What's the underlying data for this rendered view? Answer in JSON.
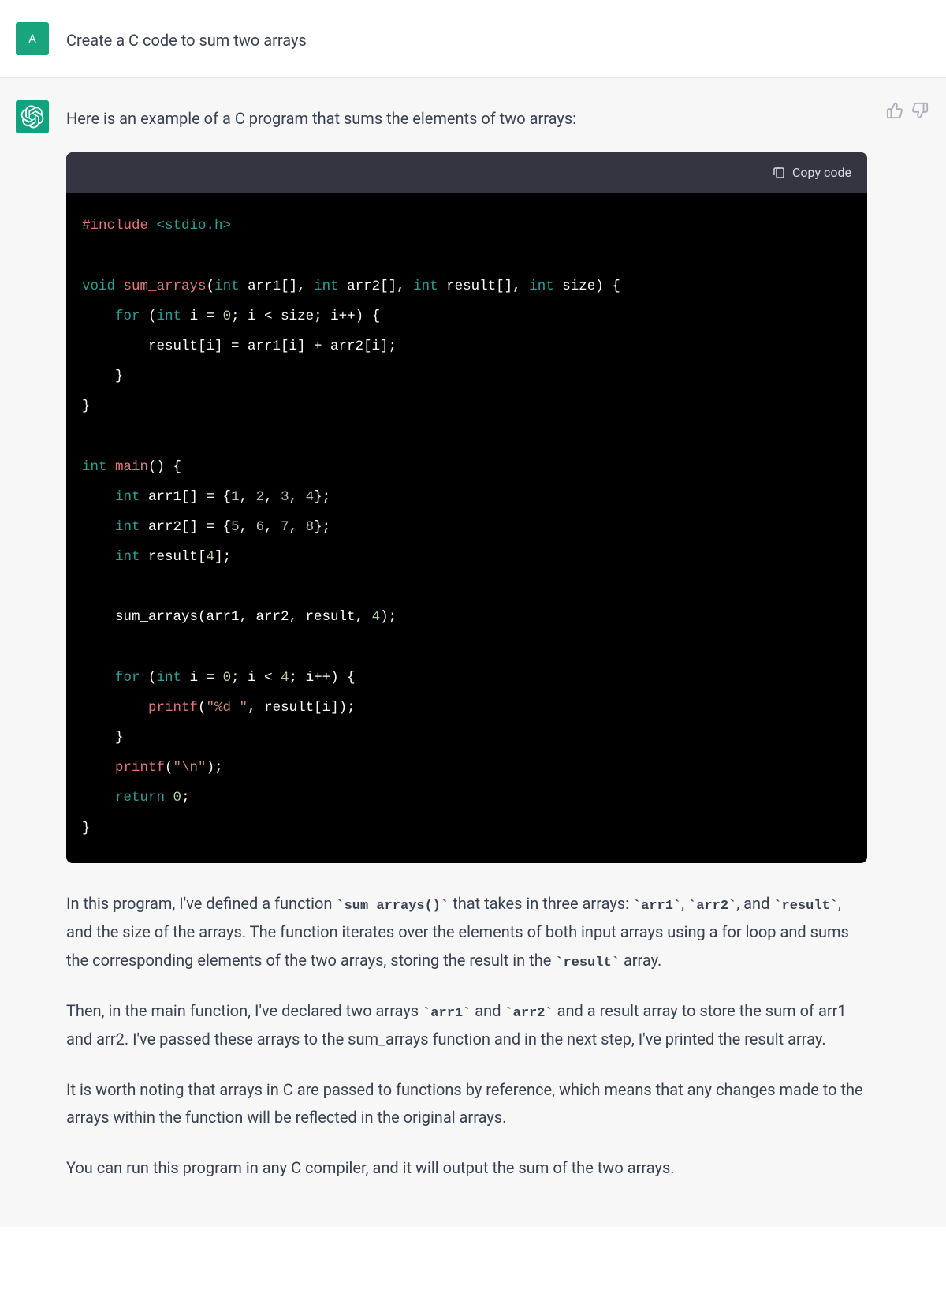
{
  "user": {
    "avatar_letter": "A",
    "message": "Create a C code to sum two arrays"
  },
  "assistant": {
    "intro": "Here is an example of a C program that sums the elements of two arrays:",
    "copy_label": "Copy code",
    "code": {
      "include_directive": "#include",
      "include_target": "<stdio.h>",
      "kw_void": "void",
      "fn_sum": "sum_arrays",
      "sig_open": "(",
      "kw_int": "int",
      "p_arr1": " arr1[], ",
      "p_arr2": " arr2[], ",
      "p_result": " result[], ",
      "p_size": " size) {",
      "for_kw": "for",
      "for1_head": " (",
      "for1_init": " i = ",
      "num0": "0",
      "for1_cond": "; i < size; i++) {",
      "body1": "        result[i] = arr1[i] + arr2[i];",
      "close_brace": "    }",
      "close_brace2": "}",
      "fn_main": "main",
      "main_sig": "() {",
      "decl_arr1_a": " arr1[] = {",
      "n1": "1",
      "n2": "2",
      "n3": "3",
      "n4": "4",
      "decl_close": "};",
      "decl_arr2_a": " arr2[] = {",
      "n5": "5",
      "n6": "6",
      "n7": "7",
      "n8": "8",
      "decl_result": " result[",
      "nr": "4",
      "decl_result_end": "];",
      "call_sum": "    sum_arrays(arr1, arr2, result, ",
      "call_sum_n": "4",
      "call_sum_end": ");",
      "for2_cond": "; i < ",
      "for2_lim": "4",
      "for2_tail": "; i++) {",
      "printf_fn": "printf",
      "printf_open": "(",
      "printf_fmt": "\"%d \"",
      "printf_rest": ", result[i]);",
      "printf_nl": "\"\\n\"",
      "printf_nl_end": ");",
      "return_kw": "return",
      "return_val": "0",
      "semi": ";"
    },
    "explain": {
      "p1_a": "In this program, I've defined a function ",
      "p1_code1": "`sum_arrays()`",
      "p1_b": " that takes in three arrays: ",
      "p1_code2": "`arr1`",
      "p1_c": ", ",
      "p1_code3": "`arr2`",
      "p1_d": ", and ",
      "p1_code4": "`result`",
      "p1_e": ", and the size of the arrays. The function iterates over the elements of both input arrays using a for loop and sums the corresponding elements of the two arrays, storing the result in the ",
      "p1_code5": "`result`",
      "p1_f": " array.",
      "p2_a": "Then, in the main function, I've declared two arrays ",
      "p2_code1": "`arr1`",
      "p2_b": " and ",
      "p2_code2": "`arr2`",
      "p2_c": " and a result array to store the sum of arr1 and arr2. I've passed these arrays to the sum_arrays function and in the next step, I've printed the result array.",
      "p3": "It is worth noting that arrays in C are passed to functions by reference, which means that any changes made to the arrays within the function will be reflected in the original arrays.",
      "p4": "You can run this program in any C compiler, and it will output the sum of the two arrays."
    }
  }
}
